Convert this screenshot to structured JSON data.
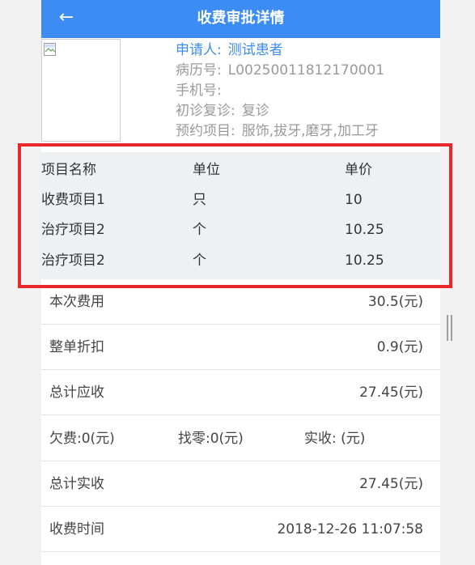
{
  "header": {
    "title": "收费审批详情",
    "back_icon": "←"
  },
  "patient": {
    "applicant_label": "申请人:",
    "applicant_value": "测试患者",
    "record_label": "病历号:",
    "record_value": "L00250011812170001",
    "phone_label": "手机号:",
    "phone_value": "",
    "visit_label": "初诊复诊:",
    "visit_value": "复诊",
    "booking_label": "预约项目:",
    "booking_value": "服饰,拔牙,磨牙,加工牙"
  },
  "items": {
    "headers": [
      "项目名称",
      "单位",
      "单价"
    ],
    "rows": [
      [
        "收费项目1",
        "只",
        "10"
      ],
      [
        "治疗项目2",
        "个",
        "10.25"
      ],
      [
        "治疗项目2",
        "个",
        "10.25"
      ]
    ]
  },
  "summary": {
    "this_fee_label": "本次费用",
    "this_fee_value": "30.5(元)",
    "discount_label": "整单折扣",
    "discount_value": "0.9(元)",
    "total_due_label": "总计应收",
    "total_due_value": "27.45(元)",
    "arrears": "欠费:0(元)",
    "change": "找零:0(元)",
    "received": "实收: (元)",
    "total_received_label": "总计实收",
    "total_received_value": "27.45(元)",
    "fee_time_label": "收费时间",
    "fee_time_value": "2018-12-26 11:07:58"
  },
  "colors": {
    "accent": "#3d8cf3",
    "highlight": "#e8272b",
    "table_bg": "#eff0f3"
  }
}
